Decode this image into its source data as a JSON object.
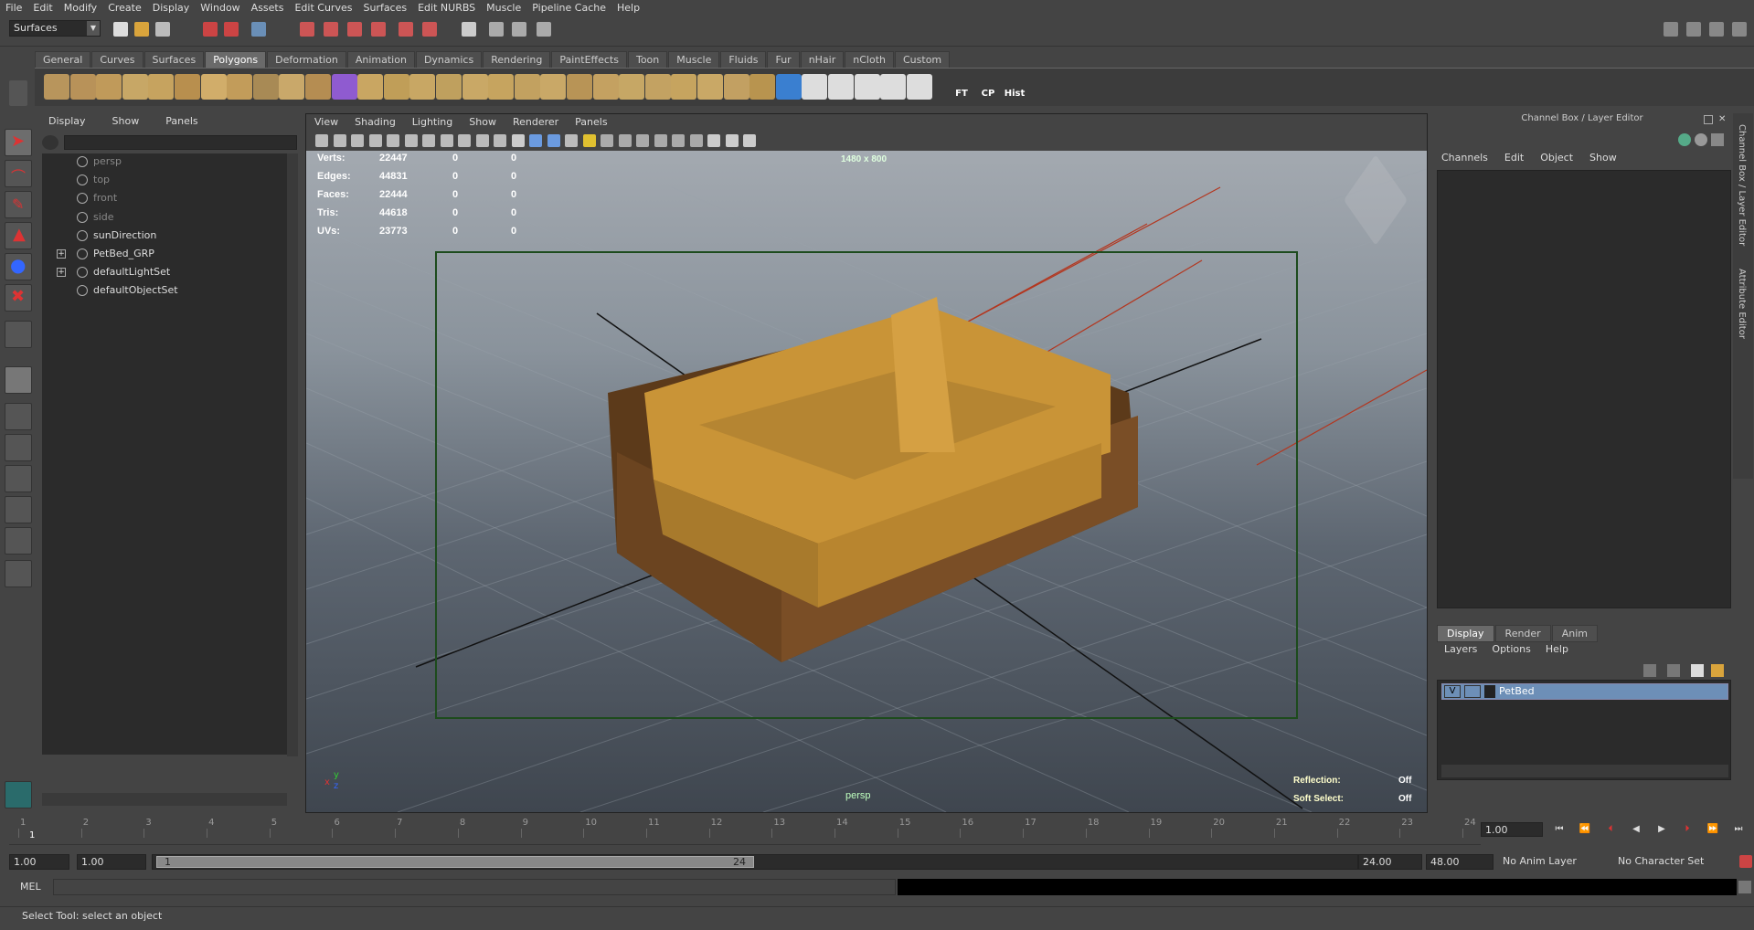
{
  "menubar": [
    "File",
    "Edit",
    "Modify",
    "Create",
    "Display",
    "Window",
    "Assets",
    "Edit Curves",
    "Surfaces",
    "Edit NURBS",
    "Muscle",
    "Pipeline Cache",
    "Help"
  ],
  "status": {
    "mode": "Surfaces"
  },
  "shelf": {
    "tabs": [
      "General",
      "Curves",
      "Surfaces",
      "Polygons",
      "Deformation",
      "Animation",
      "Dynamics",
      "Rendering",
      "PaintEffects",
      "Toon",
      "Muscle",
      "Fluids",
      "Fur",
      "nHair",
      "nCloth",
      "Custom"
    ],
    "active": "Polygons",
    "text_icons": [
      "FT",
      "CP",
      "Hist"
    ]
  },
  "outliner": {
    "menu": [
      "Display",
      "Show",
      "Panels"
    ],
    "items": [
      {
        "label": "persp",
        "dim": true
      },
      {
        "label": "top",
        "dim": true
      },
      {
        "label": "front",
        "dim": true
      },
      {
        "label": "side",
        "dim": true
      },
      {
        "label": "sunDirection",
        "dim": false
      },
      {
        "label": "PetBed_GRP",
        "dim": false,
        "expand": true
      },
      {
        "label": "defaultLightSet",
        "dim": false,
        "expand": true
      },
      {
        "label": "defaultObjectSet",
        "dim": false
      }
    ]
  },
  "viewport": {
    "menu": [
      "View",
      "Shading",
      "Lighting",
      "Show",
      "Renderer",
      "Panels"
    ],
    "stats": [
      {
        "label": "Verts:",
        "v1": "22447",
        "v2": "0",
        "v3": "0"
      },
      {
        "label": "Edges:",
        "v1": "44831",
        "v2": "0",
        "v3": "0"
      },
      {
        "label": "Faces:",
        "v1": "22444",
        "v2": "0",
        "v3": "0"
      },
      {
        "label": "Tris:",
        "v1": "44618",
        "v2": "0",
        "v3": "0"
      },
      {
        "label": "UVs:",
        "v1": "23773",
        "v2": "0",
        "v3": "0"
      }
    ],
    "resolution": "1480 x 800",
    "camera": "persp",
    "reflection_label": "Reflection:",
    "reflection_value": "Off",
    "softselect_label": "Soft Select:",
    "softselect_value": "Off"
  },
  "channelbox": {
    "title": "Channel Box / Layer Editor",
    "menu": [
      "Channels",
      "Edit",
      "Object",
      "Show"
    ],
    "layer_tabs": [
      "Display",
      "Render",
      "Anim"
    ],
    "layer_active": "Display",
    "layer_menu": [
      "Layers",
      "Options",
      "Help"
    ],
    "layer": {
      "v": "V",
      "name": "PetBed"
    }
  },
  "side_tabs": [
    "Channel Box / Layer Editor",
    "Attribute Editor"
  ],
  "timeline": {
    "ticks": [
      "1",
      "2",
      "3",
      "4",
      "5",
      "6",
      "7",
      "8",
      "9",
      "10",
      "11",
      "12",
      "13",
      "14",
      "15",
      "16",
      "17",
      "18",
      "19",
      "20",
      "21",
      "22",
      "23",
      "24"
    ],
    "current": "1",
    "current_field": "1.00"
  },
  "range": {
    "start": "1.00",
    "playback_start": "1.00",
    "slider_start": "1",
    "slider_end": "24",
    "playback_end": "24.00",
    "end": "48.00",
    "anim_layer": "No Anim Layer",
    "char_set": "No Character Set"
  },
  "cmd": {
    "label": "MEL"
  },
  "help": "Select Tool: select an object"
}
